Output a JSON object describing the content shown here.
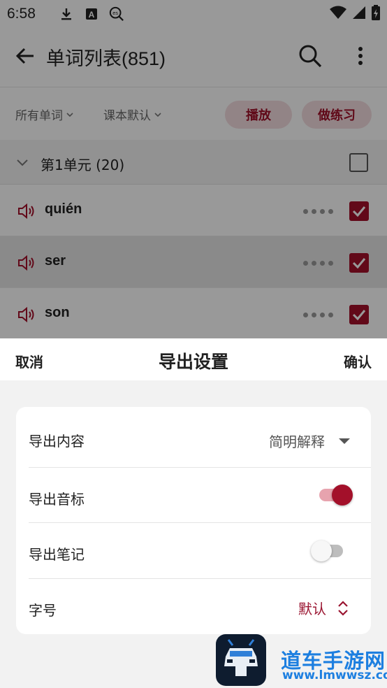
{
  "status": {
    "time": "6:58"
  },
  "appbar": {
    "title": "单词列表(851)"
  },
  "filters": {
    "all_words": "所有单词",
    "book_default": "课本默认",
    "play": "播放",
    "practice": "做练习"
  },
  "unit": {
    "label": "第1单元 (20)",
    "checked": false
  },
  "words": [
    {
      "text": "quién",
      "checked": true
    },
    {
      "text": "ser",
      "checked": true
    },
    {
      "text": "son",
      "checked": true
    }
  ],
  "sheet": {
    "cancel": "取消",
    "title": "导出设置",
    "confirm": "确认",
    "rows": {
      "content_label": "导出内容",
      "content_value": "简明解释",
      "phonetic_label": "导出音标",
      "phonetic_on": true,
      "notes_label": "导出笔记",
      "notes_on": false,
      "font_label": "字号",
      "font_value": "默认"
    }
  },
  "colors": {
    "accent": "#a3102a",
    "pill_bg": "#f4dde0",
    "watermark": "#1d7fe0"
  },
  "watermark": {
    "name": "道车手游网",
    "url": "www.lmwwsz.com"
  }
}
